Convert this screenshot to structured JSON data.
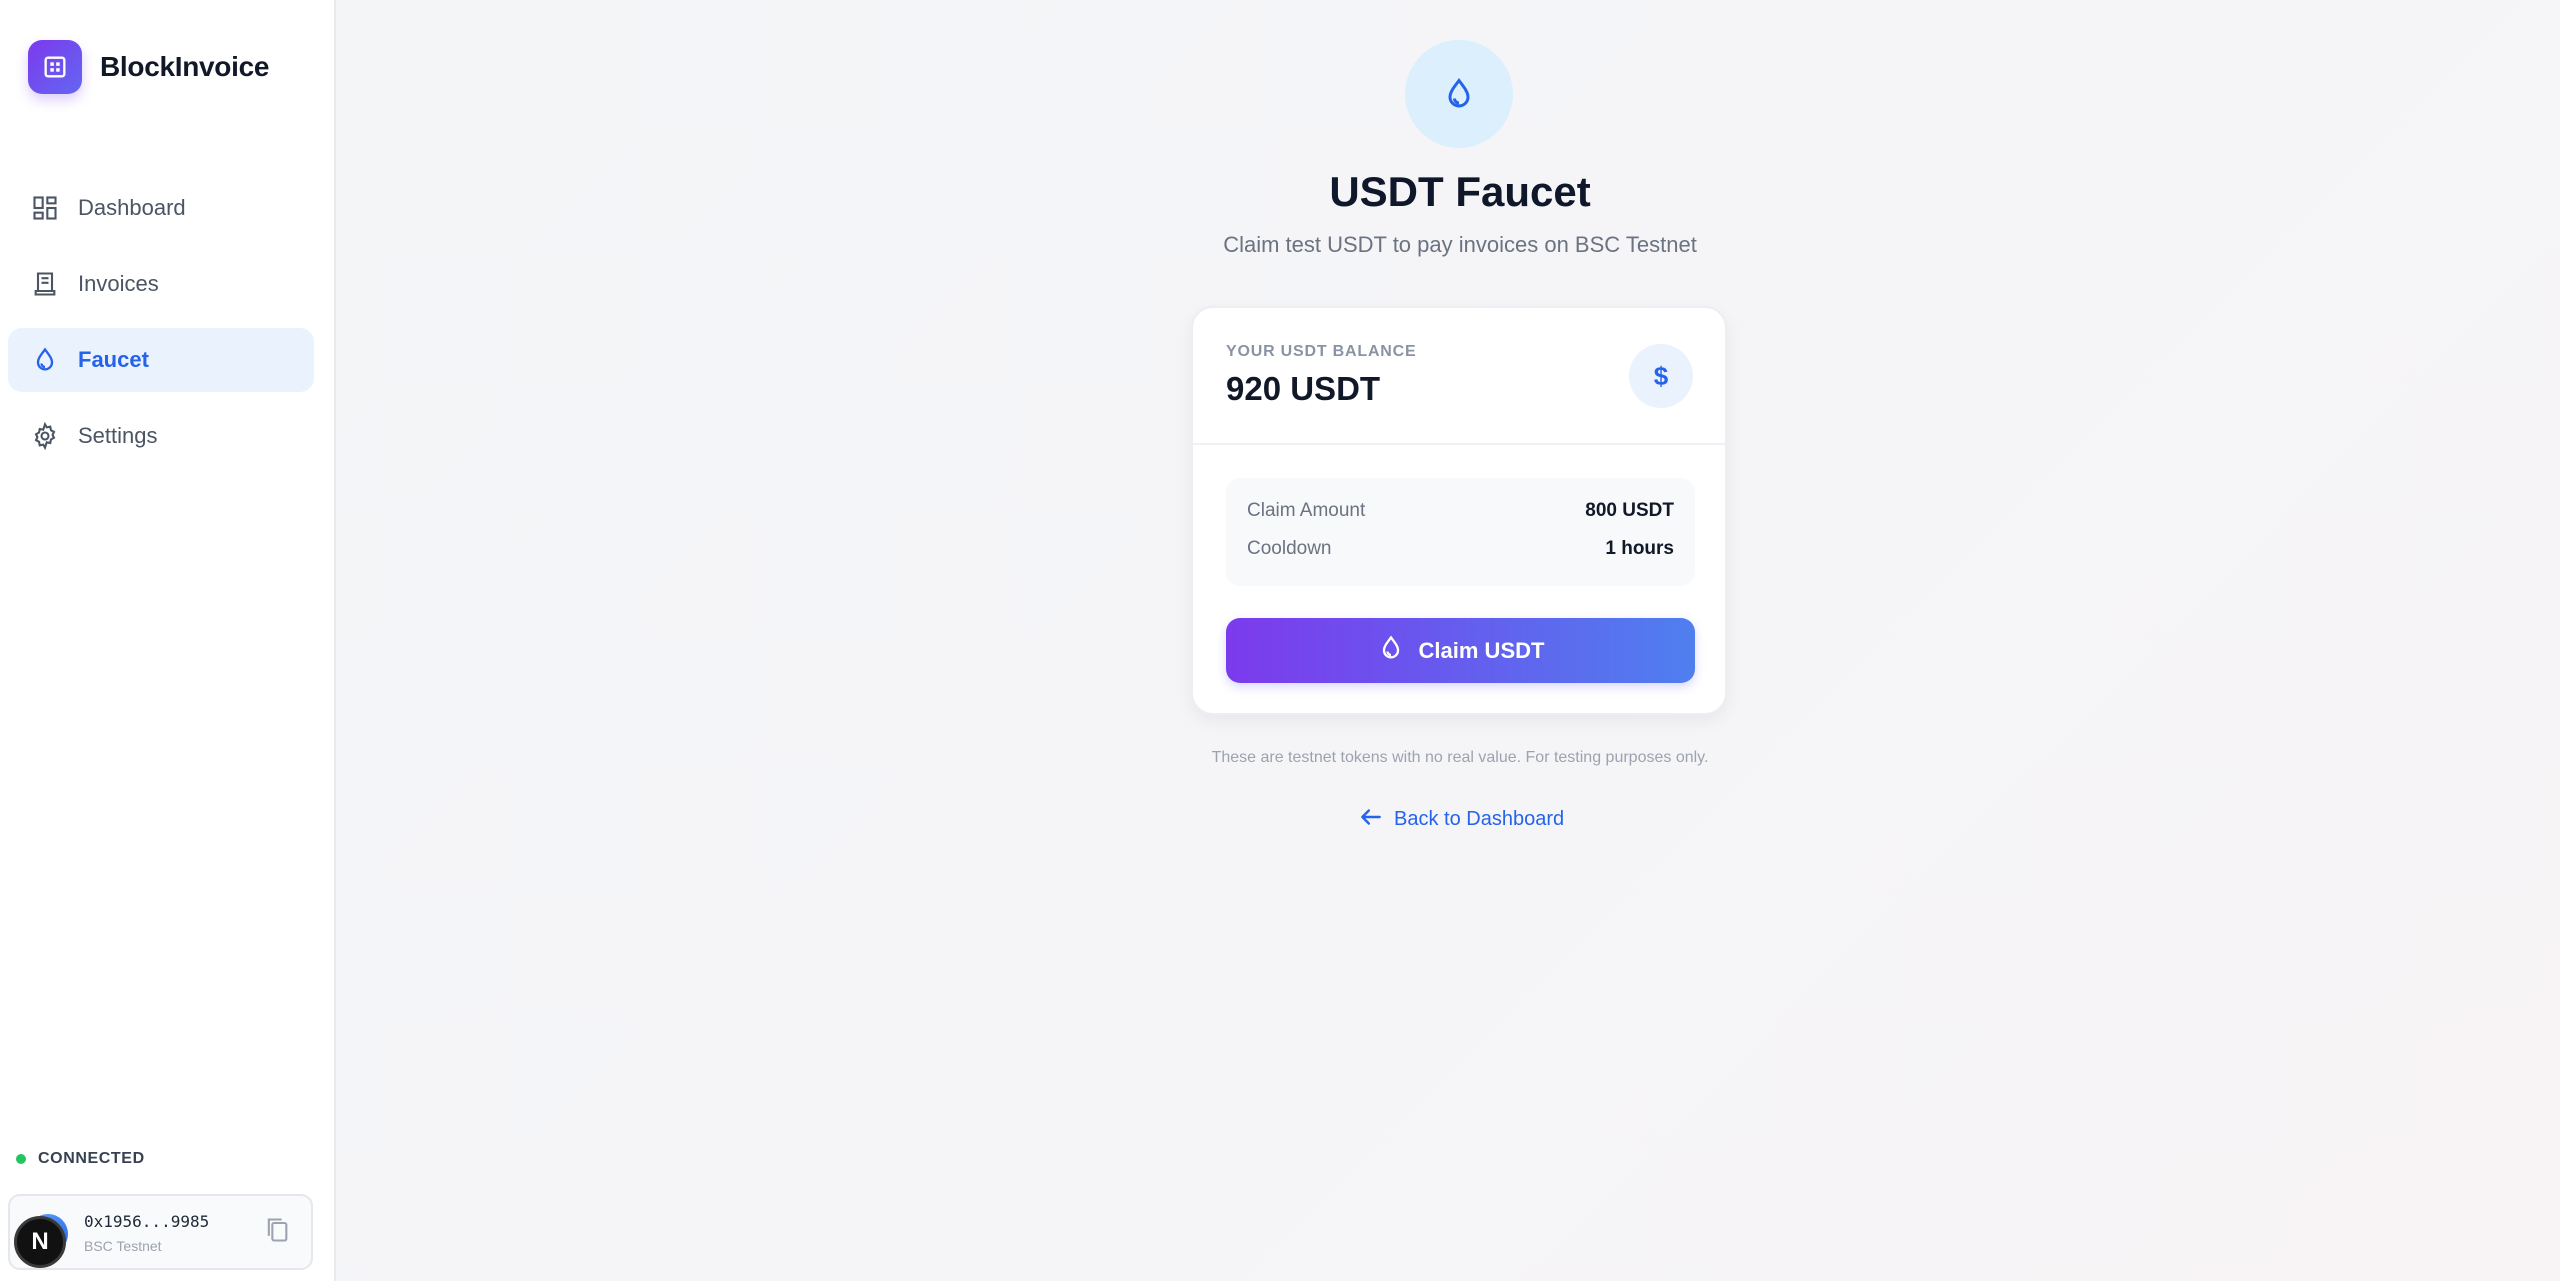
{
  "app": {
    "name": "BlockInvoice"
  },
  "sidebar": {
    "items": [
      {
        "label": "Dashboard",
        "icon": "dashboard-icon",
        "active": false
      },
      {
        "label": "Invoices",
        "icon": "receipt-icon",
        "active": false
      },
      {
        "label": "Faucet",
        "icon": "droplet-icon",
        "active": true
      },
      {
        "label": "Settings",
        "icon": "gear-icon",
        "active": false
      }
    ],
    "connection": {
      "status": "CONNECTED",
      "status_color": "#22c55e"
    },
    "wallet": {
      "address": "0x1956...9985",
      "network": "BSC Testnet",
      "badge": "N"
    }
  },
  "main": {
    "title": "USDT Faucet",
    "subtitle": "Claim test USDT to pay invoices on BSC Testnet",
    "balance": {
      "label": "YOUR USDT BALANCE",
      "value": "920 USDT",
      "icon_symbol": "$"
    },
    "details": {
      "claim_amount_label": "Claim Amount",
      "claim_amount_value": "800 USDT",
      "cooldown_label": "Cooldown",
      "cooldown_value": "1 hours"
    },
    "claim_button": "Claim USDT",
    "note": "These are testnet tokens with no real value. For testing purposes only.",
    "back_link": "Back to Dashboard"
  },
  "colors": {
    "accent": "#2563eb",
    "brand_purple": "#7c3aed"
  }
}
